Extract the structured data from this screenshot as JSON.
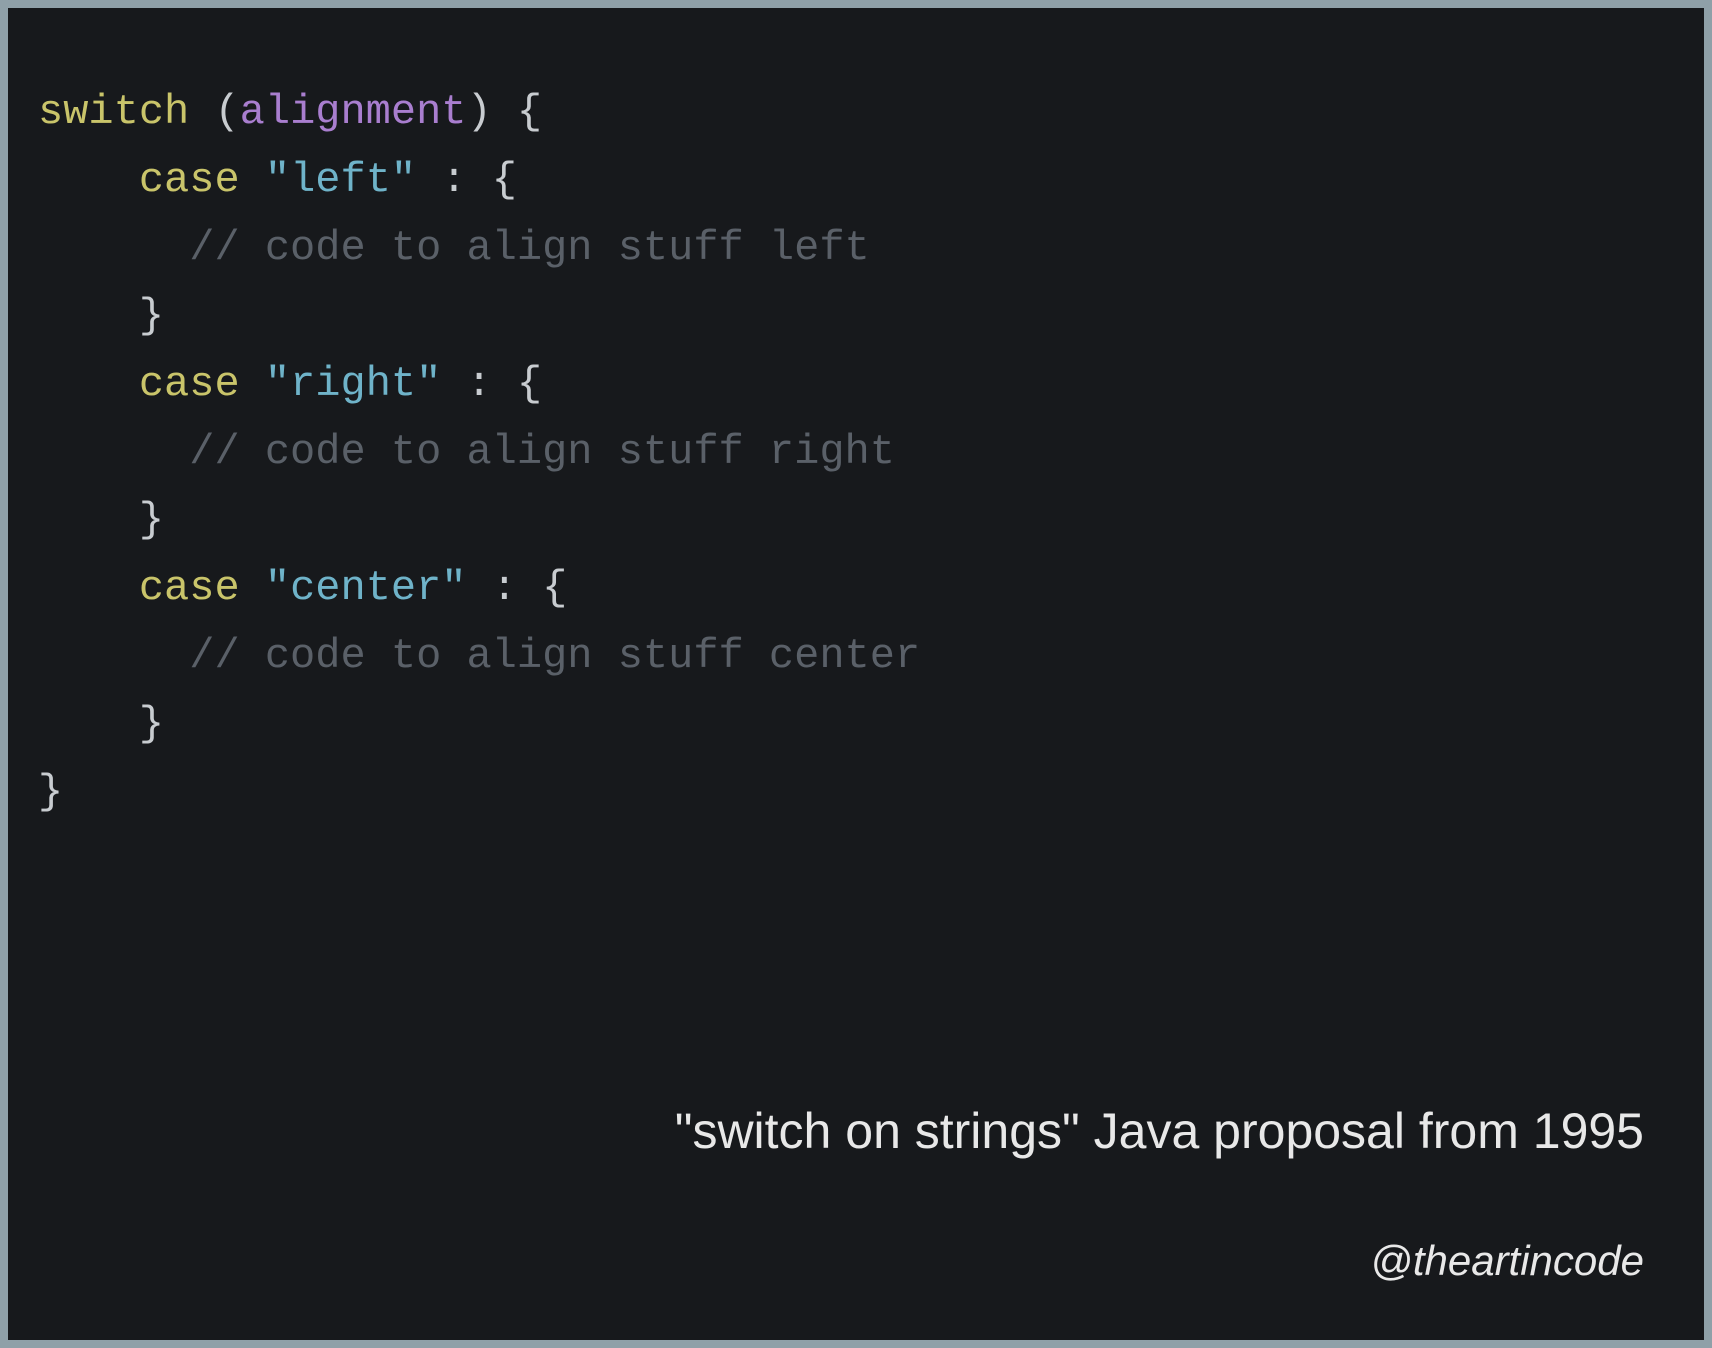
{
  "code": {
    "switch_kw": "switch",
    "open_paren": " (",
    "ident": "alignment",
    "close_paren_brace": ") {",
    "case_kw": "case",
    "colon_brace": " : {",
    "close_brace": "}",
    "cases": [
      {
        "literal": "\"left\"",
        "comment": "// code to align stuff left"
      },
      {
        "literal": "\"right\"",
        "comment": "// code to align stuff right"
      },
      {
        "literal": "\"center\"",
        "comment": "// code to align stuff center"
      }
    ]
  },
  "caption": "\"switch on strings\" Java proposal from 1995",
  "handle": "@theartincode"
}
